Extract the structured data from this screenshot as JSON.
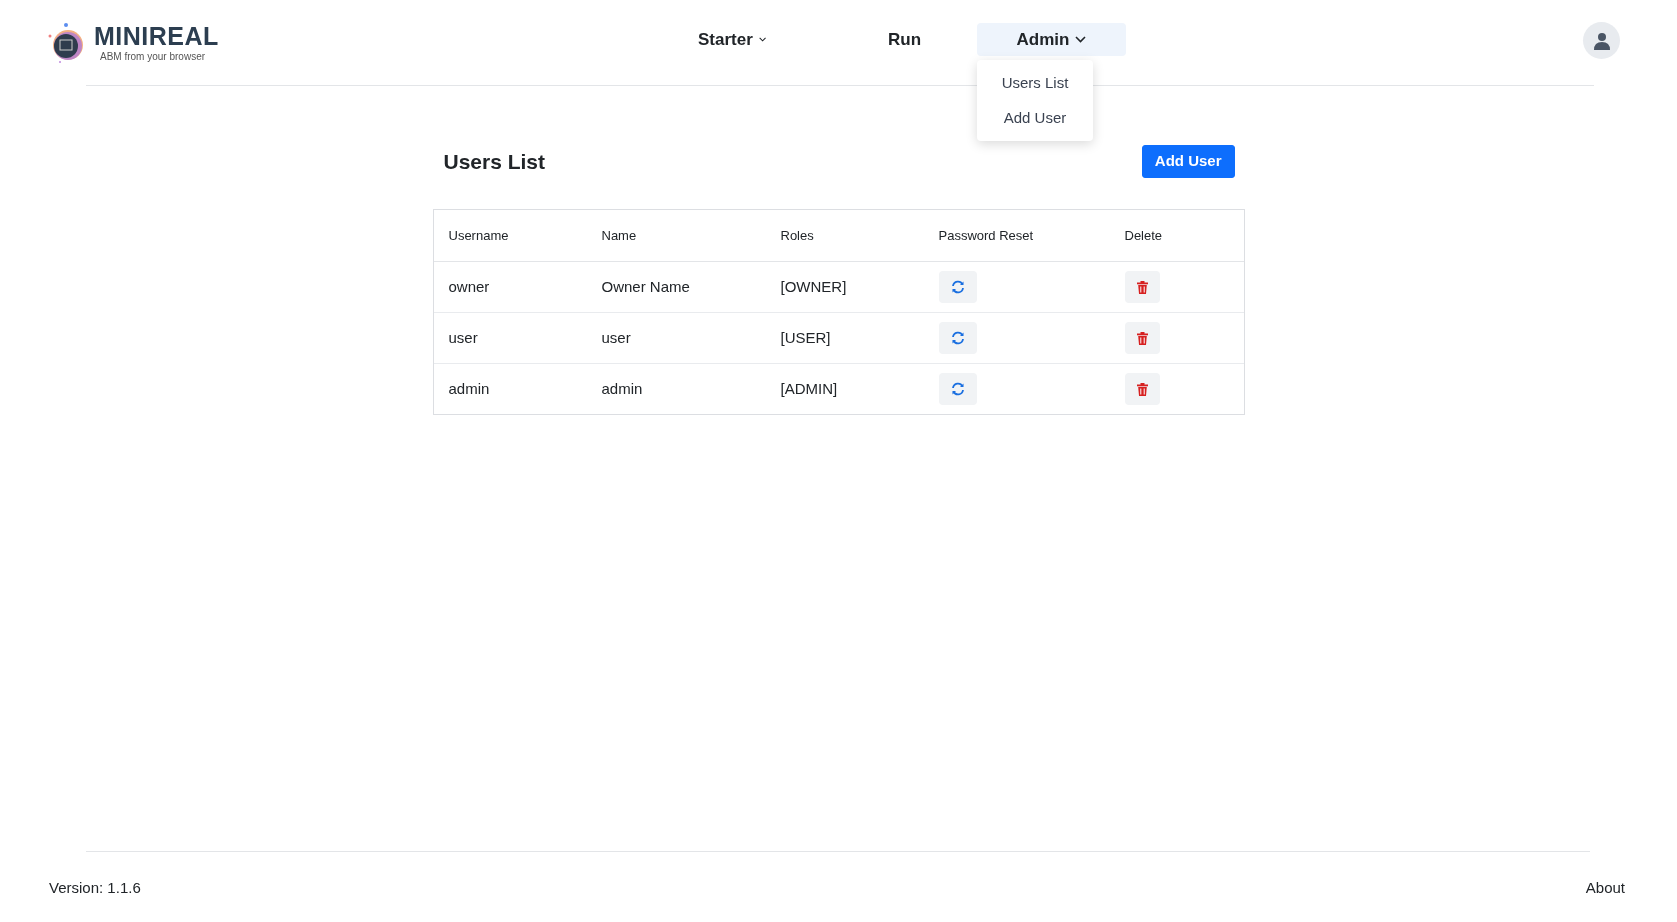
{
  "brand": {
    "name": "MINIREAL",
    "tagline": "ABM from your browser"
  },
  "nav": [
    {
      "label": "Starter",
      "has_menu": true,
      "expanded": false
    },
    {
      "label": "Run",
      "has_menu": false,
      "expanded": false
    },
    {
      "label": "Admin",
      "has_menu": true,
      "expanded": true,
      "menu": [
        "Users List",
        "Add User"
      ]
    }
  ],
  "page": {
    "title": "Users List",
    "add_button": "Add User"
  },
  "table": {
    "columns": [
      "Username",
      "Name",
      "Roles",
      "Password Reset",
      "Delete"
    ],
    "rows": [
      {
        "username": "owner",
        "name": "Owner Name",
        "roles": "[OWNER]"
      },
      {
        "username": "user",
        "name": "user",
        "roles": "[USER]"
      },
      {
        "username": "admin",
        "name": "admin",
        "roles": "[ADMIN]"
      }
    ]
  },
  "footer": {
    "version": "Version: 1.1.6",
    "about": "About"
  }
}
